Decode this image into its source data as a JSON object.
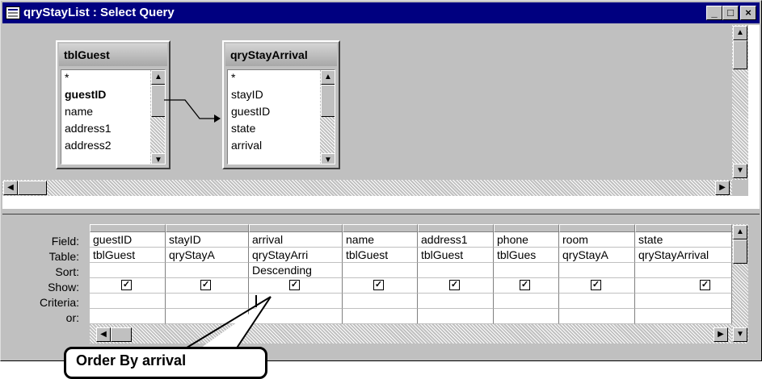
{
  "window": {
    "title": "qryStayList : Select Query",
    "minimize_glyph": "_",
    "restore_glyph": "□",
    "close_glyph": "×"
  },
  "tables": [
    {
      "name": "tblGuest",
      "fields": [
        "*",
        "guestID",
        "name",
        "address1",
        "address2"
      ],
      "bold_field": "guestID"
    },
    {
      "name": "qryStayArrival",
      "fields": [
        "*",
        "stayID",
        "guestID",
        "state",
        "arrival"
      ]
    }
  ],
  "grid": {
    "row_labels": [
      "Field:",
      "Table:",
      "Sort:",
      "Show:",
      "Criteria:",
      "or:"
    ],
    "columns": [
      {
        "field": "guestID",
        "table": "tblGuest",
        "sort": "",
        "show": true
      },
      {
        "field": "stayID",
        "table": "qryStayA",
        "sort": "",
        "show": true
      },
      {
        "field": "arrival",
        "table": "qryStayArri",
        "sort": "Descending",
        "show": true
      },
      {
        "field": "name",
        "table": "tblGuest",
        "sort": "",
        "show": true
      },
      {
        "field": "address1",
        "table": "tblGuest",
        "sort": "",
        "show": true
      },
      {
        "field": "phone",
        "table": "tblGues",
        "sort": "",
        "show": true
      },
      {
        "field": "room",
        "table": "qryStayA",
        "sort": "",
        "show": true
      },
      {
        "field": "state",
        "table": "qryStayArrival",
        "sort": "",
        "show": true
      }
    ]
  },
  "callout": {
    "text": "Order By arrival"
  },
  "icons": {
    "check": "✓",
    "up": "▲",
    "down": "▼",
    "left": "◀",
    "right": "▶"
  }
}
